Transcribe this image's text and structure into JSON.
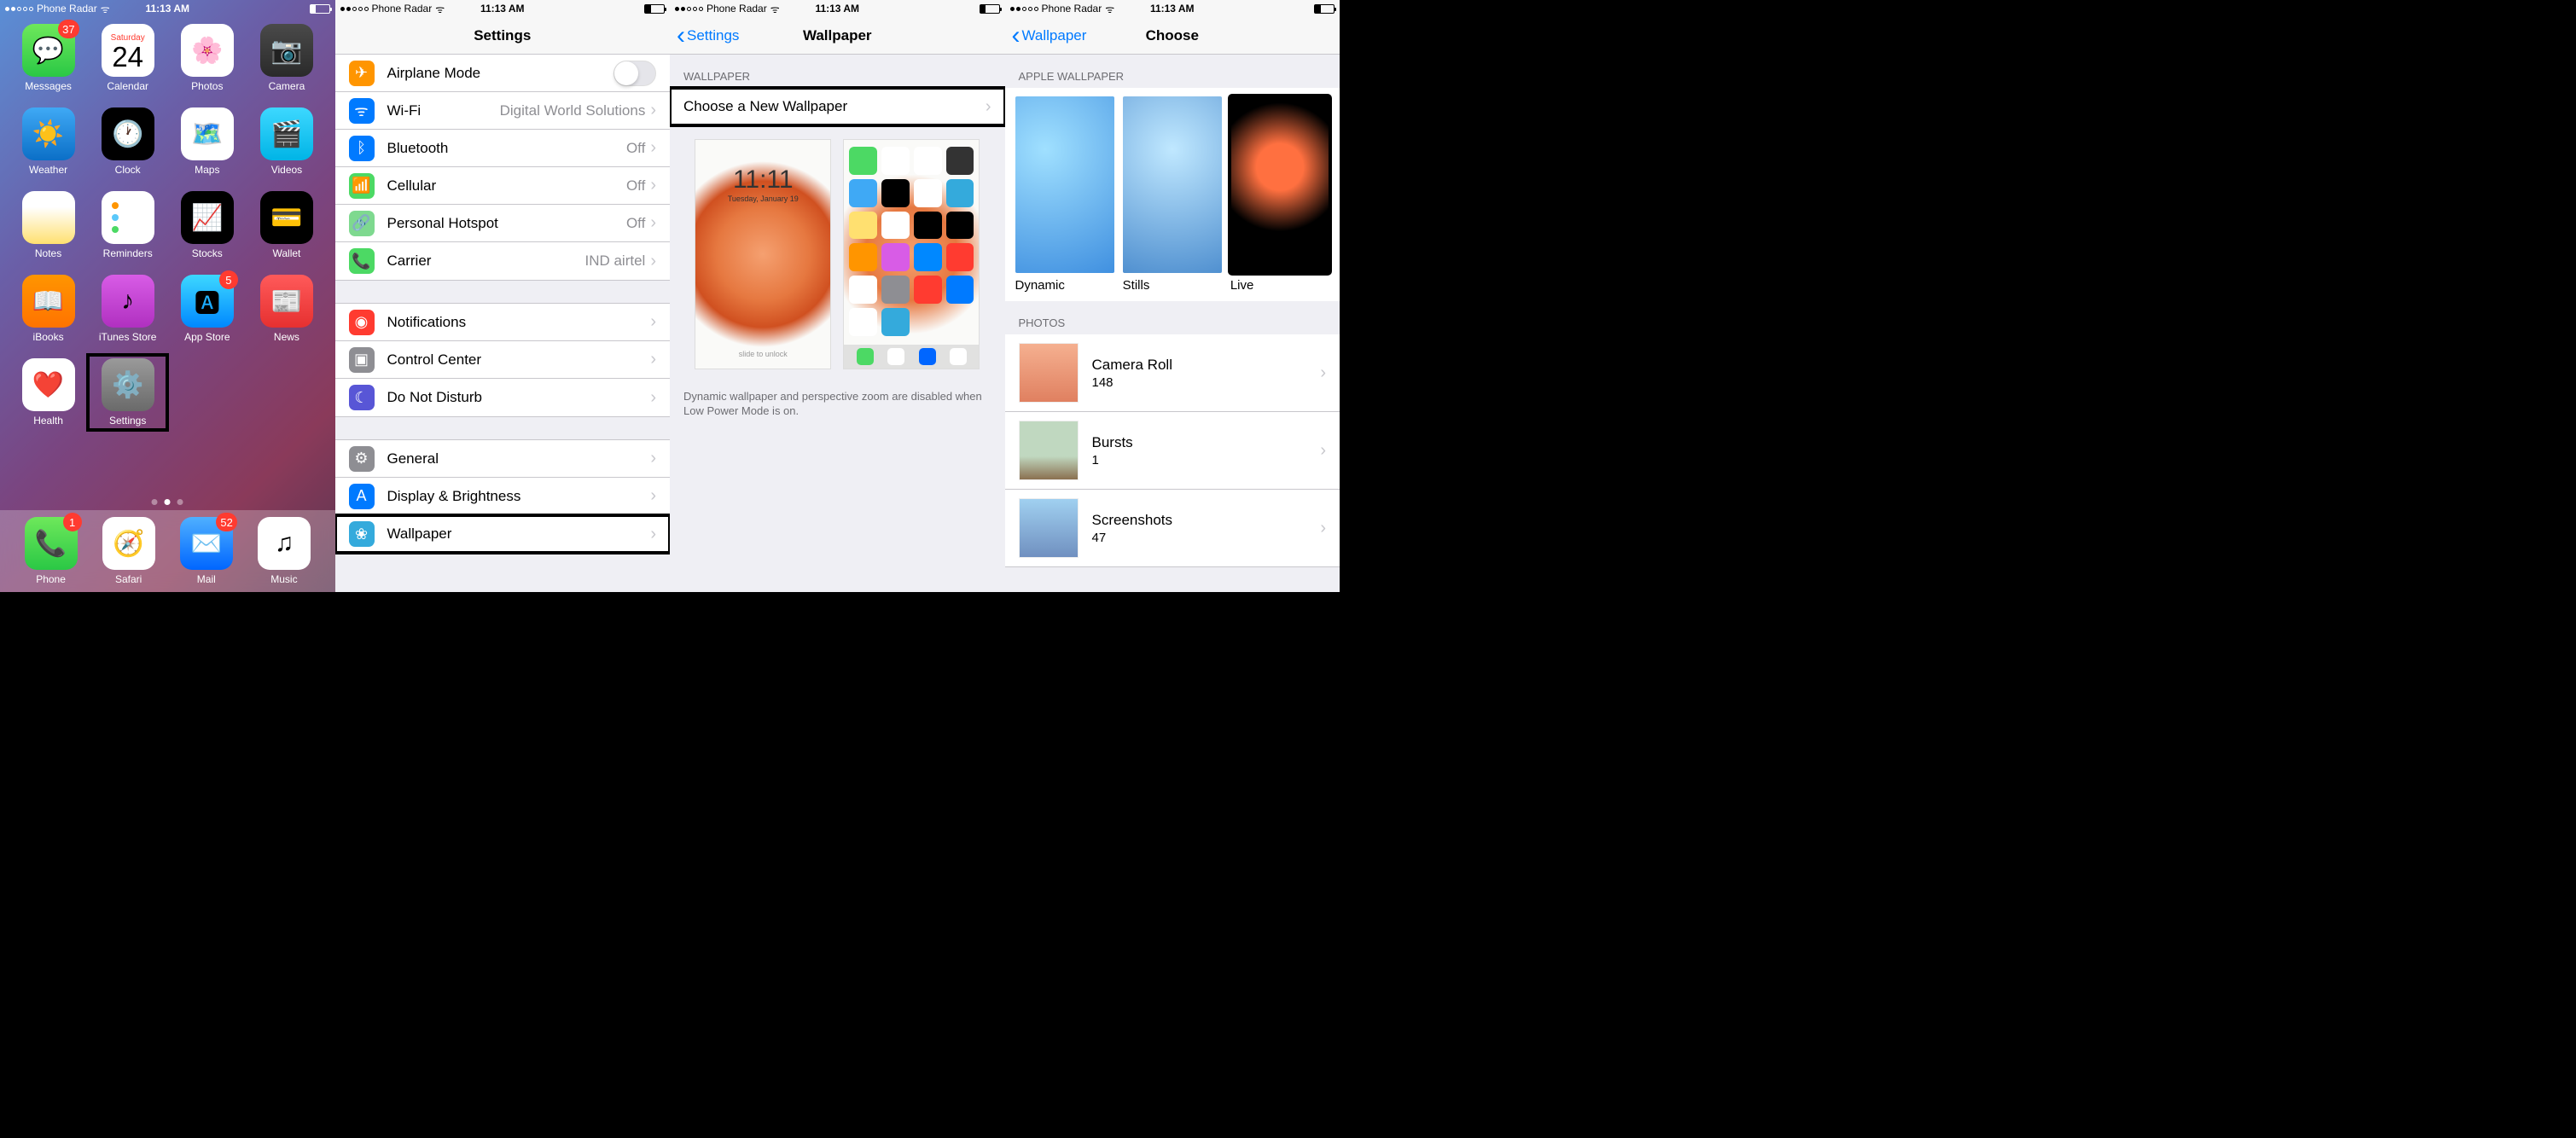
{
  "status": {
    "carrier": "Phone Radar",
    "time": "11:13 AM"
  },
  "home": {
    "apps": [
      {
        "name": "Messages",
        "bg": "linear-gradient(#6ee85b,#2ac845)",
        "icon": "💬",
        "badge": "37"
      },
      {
        "name": "Calendar",
        "day": "Saturday",
        "num": "24"
      },
      {
        "name": "Photos",
        "bg": "#fff",
        "icon": "🌸"
      },
      {
        "name": "Camera",
        "bg": "linear-gradient(#4a4a4a,#2a2a2a)",
        "icon": "📷"
      },
      {
        "name": "Weather",
        "bg": "linear-gradient(#3fa9f5,#0b6fc7)",
        "icon": "☀️"
      },
      {
        "name": "Clock",
        "bg": "#000",
        "icon": "🕐"
      },
      {
        "name": "Maps",
        "bg": "#fff",
        "icon": "🗺️"
      },
      {
        "name": "Videos",
        "bg": "linear-gradient(#3dd8ff,#00b4e6)",
        "icon": "🎬"
      },
      {
        "name": "Notes",
        "bg": "linear-gradient(#fff 30%,#ffe070)",
        "icon": ""
      },
      {
        "name": "Reminders",
        "bg": "#fff",
        "icon": ""
      },
      {
        "name": "Stocks",
        "bg": "#000",
        "icon": "📈"
      },
      {
        "name": "Wallet",
        "bg": "#000",
        "icon": "💳"
      },
      {
        "name": "iBooks",
        "bg": "linear-gradient(#ff9500,#ff7300)",
        "icon": "📖"
      },
      {
        "name": "iTunes Store",
        "bg": "linear-gradient(#d85ce6,#b030c0)",
        "icon": "♪"
      },
      {
        "name": "App Store",
        "bg": "linear-gradient(#3dd8ff,#0088ff)",
        "icon": "🅰",
        "badge": "5"
      },
      {
        "name": "News",
        "bg": "linear-gradient(#ff5a5a,#e63030)",
        "icon": "📰"
      },
      {
        "name": "Health",
        "bg": "#fff",
        "icon": "❤️"
      },
      {
        "name": "Settings",
        "bg": "linear-gradient(#9a9a9a,#6a6a6a)",
        "icon": "⚙️",
        "highlight": true
      }
    ],
    "dock": [
      {
        "name": "Phone",
        "bg": "linear-gradient(#6ee85b,#2ac845)",
        "icon": "📞",
        "badge": "1"
      },
      {
        "name": "Safari",
        "bg": "#fff",
        "icon": "🧭"
      },
      {
        "name": "Mail",
        "bg": "linear-gradient(#4fb0ff,#0066ff)",
        "icon": "✉️",
        "badge": "52"
      },
      {
        "name": "Music",
        "bg": "#fff",
        "icon": "♫"
      }
    ]
  },
  "settings": {
    "title": "Settings",
    "groups": [
      [
        {
          "icon": "✈",
          "bg": "#ff9500",
          "label": "Airplane Mode",
          "toggle": true
        },
        {
          "icon": "ᯤ",
          "bg": "#007aff",
          "label": "Wi-Fi",
          "value": "Digital World Solutions"
        },
        {
          "icon": "ᛒ",
          "bg": "#007aff",
          "label": "Bluetooth",
          "value": "Off"
        },
        {
          "icon": "📶",
          "bg": "#4cd964",
          "label": "Cellular",
          "value": "Off"
        },
        {
          "icon": "🔗",
          "bg": "#7ed98f",
          "label": "Personal Hotspot",
          "value": "Off"
        },
        {
          "icon": "📞",
          "bg": "#4cd964",
          "label": "Carrier",
          "value": "IND airtel"
        }
      ],
      [
        {
          "icon": "◉",
          "bg": "#ff3b30",
          "label": "Notifications"
        },
        {
          "icon": "▣",
          "bg": "#8e8e93",
          "label": "Control Center"
        },
        {
          "icon": "☾",
          "bg": "#5856d6",
          "label": "Do Not Disturb"
        }
      ],
      [
        {
          "icon": "⚙",
          "bg": "#8e8e93",
          "label": "General"
        },
        {
          "icon": "A",
          "bg": "#007aff",
          "label": "Display & Brightness"
        },
        {
          "icon": "❀",
          "bg": "#34aadc",
          "label": "Wallpaper",
          "highlight": true
        }
      ]
    ]
  },
  "wallpaper": {
    "back": "Settings",
    "title": "Wallpaper",
    "section": "WALLPAPER",
    "choose": "Choose a New Wallpaper",
    "lock_time": "11:11",
    "lock_date": "Tuesday, January 19",
    "slide": "slide to unlock",
    "footer": "Dynamic wallpaper and perspective zoom are disabled when Low Power Mode is on."
  },
  "choose": {
    "back": "Wallpaper",
    "title": "Choose",
    "section1": "APPLE WALLPAPER",
    "items": [
      {
        "label": "Dynamic",
        "bg": "radial-gradient(circle at 30% 30%, #a0e0ff, #4090e0)"
      },
      {
        "label": "Stills",
        "bg": "radial-gradient(circle at 50% 30%, #c0e8ff, #5090d0)"
      },
      {
        "label": "Live",
        "bg": "radial-gradient(circle at 50% 40%, #ff7040 20%, #000 55%)",
        "highlight": true
      }
    ],
    "section2": "PHOTOS",
    "albums": [
      {
        "name": "Camera Roll",
        "count": "148",
        "bg": "linear-gradient(#f5b090,#e08060)"
      },
      {
        "name": "Bursts",
        "count": "1",
        "bg": "linear-gradient(#c0d8c0 60%,#8a7050)"
      },
      {
        "name": "Screenshots",
        "count": "47",
        "bg": "linear-gradient(#a0d0f0,#7090c0)"
      }
    ]
  }
}
